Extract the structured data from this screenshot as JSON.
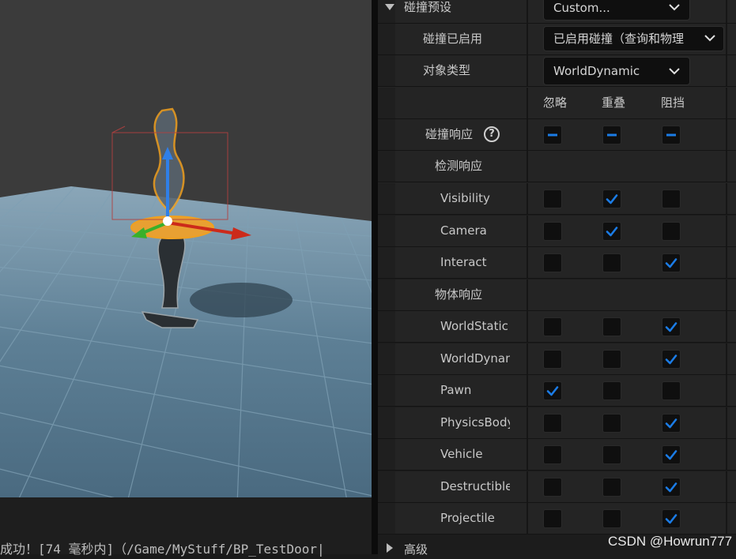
{
  "details": {
    "collision_preset": {
      "label": "碰撞预设",
      "value": "Custom..."
    },
    "collision_enabled": {
      "label": "碰撞已启用",
      "value": "已启用碰撞（查询和物理"
    },
    "object_type": {
      "label": "对象类型",
      "value": "WorldDynamic"
    },
    "columns": {
      "ignore": "忽略",
      "overlap": "重叠",
      "block": "阻挡"
    },
    "collision_responses": {
      "label": "碰撞响应",
      "help_glyph": "?"
    },
    "trace_responses": {
      "label": "检测响应",
      "items": [
        {
          "label": "Visibility",
          "state": "overlap"
        },
        {
          "label": "Camera",
          "state": "overlap"
        },
        {
          "label": "Interact",
          "state": "block"
        }
      ]
    },
    "object_responses": {
      "label": "物体响应",
      "items": [
        {
          "label": "WorldStatic",
          "state": "block"
        },
        {
          "label": "WorldDynan",
          "state": "block"
        },
        {
          "label": "Pawn",
          "state": "ignore"
        },
        {
          "label": "PhysicsBody",
          "state": "block"
        },
        {
          "label": "Vehicle",
          "state": "block"
        },
        {
          "label": "Destructible",
          "state": "block"
        },
        {
          "label": "Projectile",
          "state": "block"
        }
      ]
    },
    "advanced": {
      "label": "高级"
    }
  },
  "log": {
    "text": "成功！[74 毫秒内]（/Game/MyStuff/BP_TestDoor|"
  },
  "watermark": "CSDN @Howrun777",
  "colors": {
    "accent": "#1b7ce6",
    "panel_bg": "#242424",
    "floor": "#4f6f86",
    "highlight": "#e89a1a"
  },
  "icons": {
    "dropdown": "chevron-down-icon",
    "check": "checkmark-icon",
    "indeterminate": "dash-icon",
    "help": "question-circle-icon"
  }
}
